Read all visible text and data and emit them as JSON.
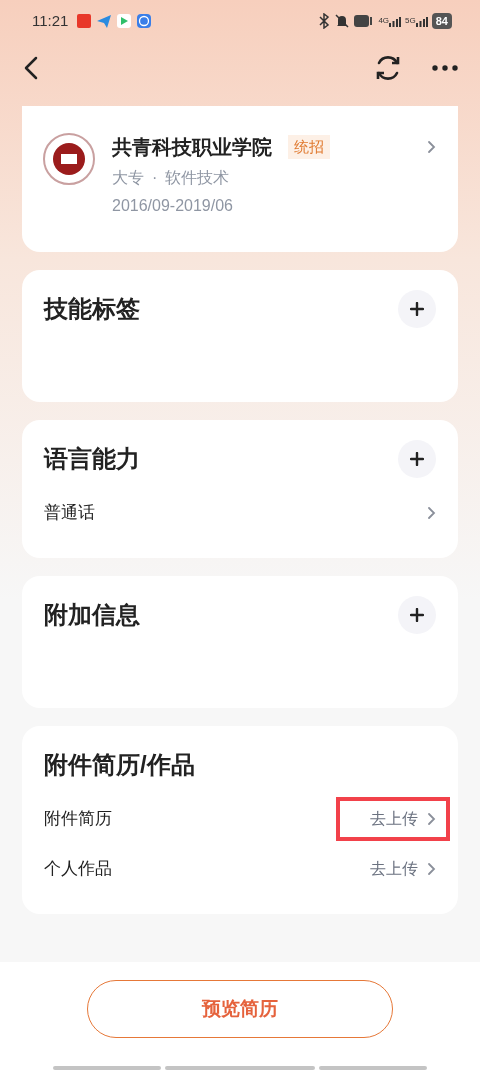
{
  "status_bar": {
    "time": "11:21",
    "signals": [
      "4G",
      "5G"
    ],
    "battery": "84"
  },
  "education": {
    "school": "共青科技职业学院",
    "tag": "统招",
    "degree": "大专",
    "separator": "·",
    "major": "软件技术",
    "period": "2016/09-2019/06"
  },
  "sections": [
    {
      "title": "技能标签",
      "addable": true
    },
    {
      "title": "语言能力",
      "addable": true,
      "rows": [
        {
          "label": "普通话",
          "highlighted": false
        }
      ]
    },
    {
      "title": "附加信息",
      "addable": true
    },
    {
      "title": "附件简历/作品",
      "addable": false,
      "rows": [
        {
          "label": "附件简历",
          "action": "去上传",
          "highlighted": true
        },
        {
          "label": "个人作品",
          "action": "去上传",
          "highlighted": false
        }
      ]
    }
  ],
  "preview_button": "预览简历"
}
